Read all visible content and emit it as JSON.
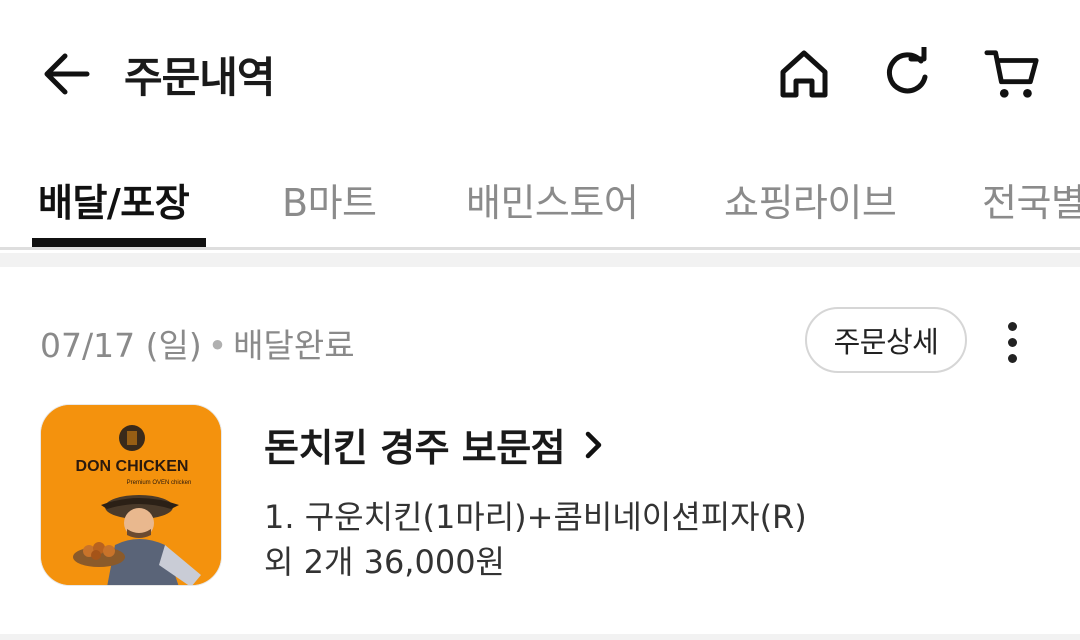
{
  "header": {
    "title": "주문내역",
    "icons": [
      "arrow-left-icon",
      "home-icon",
      "refresh-icon",
      "cart-icon"
    ]
  },
  "tabs": [
    {
      "label": "배달/포장",
      "active": true
    },
    {
      "label": "B마트",
      "active": false
    },
    {
      "label": "배민스토어",
      "active": false
    },
    {
      "label": "쇼핑라이브",
      "active": false
    },
    {
      "label": "전국별",
      "active": false
    }
  ],
  "order": {
    "date": "07/17 (일)",
    "status": "배달완료",
    "detail_button": "주문상세",
    "store_name": "돈치킨 경주 보문점",
    "item_line1": "1. 구운치킨(1마리)+콤비네이션피자(R)",
    "item_line2": "외 2개 36,000원",
    "logo": {
      "brand": "DON CHICKEN",
      "tagline": "Premium OVEN chicken",
      "background": "#f4920d"
    }
  },
  "colors": {
    "active_tab": "#111111",
    "inactive_tab": "#8b8b8b",
    "divider": "#dedede"
  }
}
